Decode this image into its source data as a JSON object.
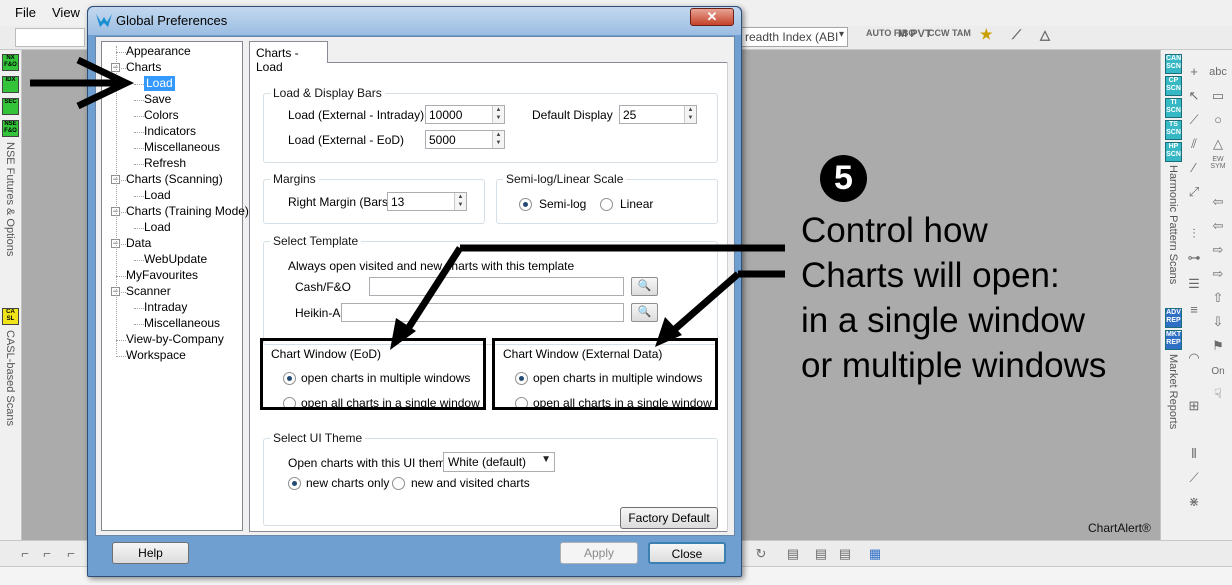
{
  "app": {
    "menu": [
      "File",
      "View"
    ],
    "symbol_combo": "readth Index (ABI",
    "toolbar_icons": [
      "AUTO FIBO",
      "M PVT",
      "CCW TAM",
      "TKS"
    ],
    "left_scans": [
      "NX F&O",
      "IDX",
      "SEC",
      "NSE F&O"
    ],
    "left_vertical_label": "NSE Futures & Options",
    "left_scan2": "CA SL",
    "left_vertical_label2": "CASL-based Scans",
    "right_scans": [
      "CAN SCN",
      "CP SCN",
      "TI SCN",
      "TS SCN",
      "HP SCN"
    ],
    "right_vertical_label": "Harmonic Pattern Scans",
    "right_scans2": [
      "ADV REP",
      "MKT REP"
    ],
    "right_vertical_label2": "Market Reports",
    "right_tool_labels": [
      "abc",
      "EW SYM",
      "On"
    ],
    "watermark": "ChartAlert®"
  },
  "dialog": {
    "title": "Global Preferences",
    "close_glyph": "✕",
    "tree": [
      {
        "label": "Appearance",
        "level": 1
      },
      {
        "label": "Charts",
        "level": 1
      },
      {
        "label": "Load",
        "level": 2,
        "selected": true
      },
      {
        "label": "Save",
        "level": 2
      },
      {
        "label": "Colors",
        "level": 2
      },
      {
        "label": "Indicators",
        "level": 2
      },
      {
        "label": "Miscellaneous",
        "level": 2
      },
      {
        "label": "Refresh",
        "level": 2
      },
      {
        "label": "Charts (Scanning)",
        "level": 1
      },
      {
        "label": "Load",
        "level": 2
      },
      {
        "label": "Charts (Training Mode)",
        "level": 1
      },
      {
        "label": "Load",
        "level": 2
      },
      {
        "label": "Data",
        "level": 1
      },
      {
        "label": "WebUpdate",
        "level": 2
      },
      {
        "label": "MyFavourites",
        "level": 1
      },
      {
        "label": "Scanner",
        "level": 1
      },
      {
        "label": "Intraday",
        "level": 2
      },
      {
        "label": "Miscellaneous",
        "level": 2
      },
      {
        "label": "View-by-Company",
        "level": 1
      },
      {
        "label": "Workspace",
        "level": 1
      }
    ],
    "tab_label": "Charts - Load",
    "load_display": {
      "title": "Load & Display Bars",
      "intraday_label": "Load (External - Intraday)",
      "intraday_value": "10000",
      "eod_label": "Load (External - EoD)",
      "eod_value": "5000",
      "default_display_label": "Default Display",
      "default_display_value": "25"
    },
    "margins": {
      "title": "Margins",
      "right_margin_label": "Right Margin (Bars)",
      "right_margin_value": "13"
    },
    "scale": {
      "title": "Semi-log/Linear Scale",
      "semilog_label": "Semi-log",
      "linear_label": "Linear",
      "selected": "Semi-log"
    },
    "template": {
      "title": "Select Template",
      "description": "Always open visited and new charts with this template",
      "cash_label": "Cash/F&O",
      "cash_value": "",
      "heikin_label": "Heikin-Ashi",
      "heikin_value": ""
    },
    "chart_window_eod": {
      "title": "Chart Window (EoD)",
      "multiple_label": "open charts in multiple windows",
      "single_label": "open all charts in a single window",
      "selected": "multiple"
    },
    "chart_window_ext": {
      "title": "Chart Window (External Data)",
      "multiple_label": "open charts in multiple windows",
      "single_label": "open all charts in a single window",
      "selected": "multiple"
    },
    "ui_theme": {
      "title": "Select UI Theme",
      "open_label": "Open charts with this UI theme",
      "theme_value": "White (default)",
      "new_only_label": "new charts only",
      "new_visited_label": "new and visited charts",
      "selected": "new charts only"
    },
    "buttons": {
      "factory_default": "Factory Default",
      "help": "Help",
      "apply": "Apply",
      "close": "Close"
    }
  },
  "annotation": {
    "bullet": "5",
    "lines": [
      "Control how",
      "Charts will open:",
      "in a single window",
      "or multiple windows"
    ]
  }
}
